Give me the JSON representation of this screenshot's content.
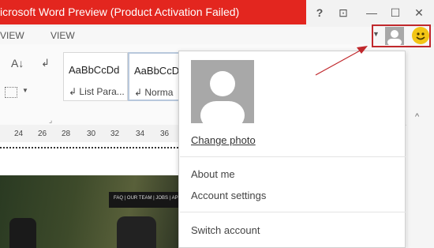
{
  "window": {
    "title": "icrosoft Word Preview (Product Activation Failed)",
    "help": "?",
    "restore_ribbon": "⊡",
    "minimize": "—",
    "maximize": "☐",
    "close": "✕"
  },
  "tabs": [
    {
      "label": "VIEW"
    },
    {
      "label": "VIEW"
    }
  ],
  "account": {
    "dropdown_arrow": "▼"
  },
  "styles": [
    {
      "sample": "AaBbCcDd",
      "name": "↲ List Para..."
    },
    {
      "sample": "AaBbCcD",
      "name": "↲ Norma"
    }
  ],
  "ruler": [
    "24",
    "26",
    "28",
    "30",
    "32",
    "34",
    "36"
  ],
  "document": {
    "nav_text": "FAQ | OUR TEAM | JOBS | API"
  },
  "panel": {
    "change_photo": "Change photo",
    "items": [
      "About me",
      "Account settings",
      "Switch account"
    ]
  }
}
